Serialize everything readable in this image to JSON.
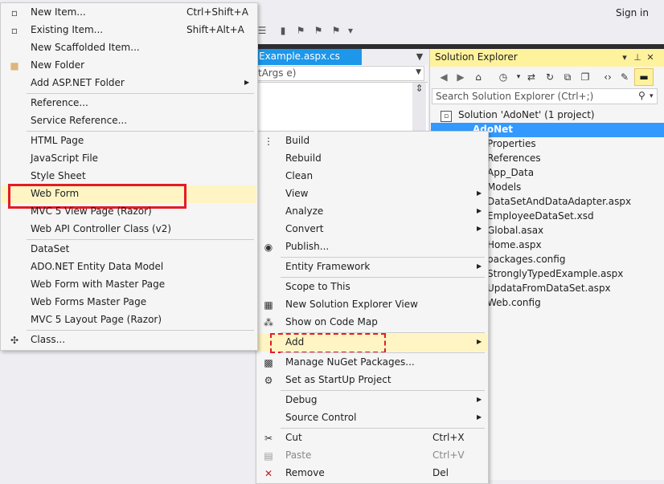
{
  "topbar": {
    "signin": "Sign in"
  },
  "editor": {
    "tab_title": "Example.aspx.cs",
    "nav_combo": "tArgs e)"
  },
  "solution_explorer": {
    "title": "Solution Explorer",
    "search_placeholder": "Search Solution Explorer (Ctrl+;)",
    "solution": "Solution 'AdoNet' (1 project)",
    "project": "AdoNet",
    "items": [
      "Properties",
      "References",
      "App_Data",
      "Models",
      "DataSetAndDataAdapter.aspx",
      "EmployeeDataSet.xsd",
      "Global.asax",
      "Home.aspx",
      "packages.config",
      "StronglyTypedExample.aspx",
      "UpdataFromDataSet.aspx",
      "Web.config"
    ]
  },
  "add_menu": {
    "items": [
      {
        "label": "New Item...",
        "shortcut": "Ctrl+Shift+A",
        "icon": "new-item-icon"
      },
      {
        "label": "Existing Item...",
        "shortcut": "Shift+Alt+A",
        "icon": "existing-item-icon"
      },
      {
        "label": "New Scaffolded Item...",
        "shortcut": "",
        "icon": ""
      },
      {
        "label": "New Folder",
        "shortcut": "",
        "icon": "folder-icon"
      },
      {
        "label": "Add ASP.NET Folder",
        "shortcut": "",
        "icon": "",
        "submenu": true
      },
      {
        "label": "Reference...",
        "shortcut": "",
        "icon": ""
      },
      {
        "label": "Service Reference...",
        "shortcut": "",
        "icon": ""
      },
      {
        "label": "HTML Page",
        "shortcut": "",
        "icon": ""
      },
      {
        "label": "JavaScript File",
        "shortcut": "",
        "icon": ""
      },
      {
        "label": "Style Sheet",
        "shortcut": "",
        "icon": ""
      },
      {
        "label": "Web Form",
        "shortcut": "",
        "icon": "",
        "highlight": true
      },
      {
        "label": "MVC 5 View Page (Razor)",
        "shortcut": "",
        "icon": ""
      },
      {
        "label": "Web API Controller Class (v2)",
        "shortcut": "",
        "icon": ""
      },
      {
        "label": "DataSet",
        "shortcut": "",
        "icon": ""
      },
      {
        "label": "ADO.NET Entity Data Model",
        "shortcut": "",
        "icon": ""
      },
      {
        "label": "Web Form with Master Page",
        "shortcut": "",
        "icon": ""
      },
      {
        "label": "Web Forms Master Page",
        "shortcut": "",
        "icon": ""
      },
      {
        "label": "MVC 5 Layout Page (Razor)",
        "shortcut": "",
        "icon": ""
      },
      {
        "label": "Class...",
        "shortcut": "",
        "icon": "class-icon"
      }
    ]
  },
  "context_menu": {
    "items": [
      {
        "label": "Build",
        "shortcut": "",
        "icon": "build-icon"
      },
      {
        "label": "Rebuild",
        "shortcut": ""
      },
      {
        "label": "Clean",
        "shortcut": ""
      },
      {
        "label": "View",
        "submenu": true
      },
      {
        "label": "Analyze",
        "submenu": true
      },
      {
        "label": "Convert",
        "submenu": true
      },
      {
        "label": "Publish...",
        "icon": "publish-icon"
      },
      {
        "label": "Entity Framework",
        "submenu": true
      },
      {
        "label": "Scope to This"
      },
      {
        "label": "New Solution Explorer View",
        "icon": "new-view-icon"
      },
      {
        "label": "Show on Code Map",
        "icon": "code-map-icon"
      },
      {
        "label": "Add",
        "submenu": true,
        "highlight": true
      },
      {
        "label": "Manage NuGet Packages...",
        "icon": "nuget-icon"
      },
      {
        "label": "Set as StartUp Project",
        "icon": "gear-icon"
      },
      {
        "label": "Debug",
        "submenu": true
      },
      {
        "label": "Source Control",
        "submenu": true
      },
      {
        "label": "Cut",
        "shortcut": "Ctrl+X",
        "icon": "cut-icon"
      },
      {
        "label": "Paste",
        "shortcut": "Ctrl+V",
        "icon": "paste-icon",
        "disabled": true
      },
      {
        "label": "Remove",
        "shortcut": "Del",
        "icon": "remove-icon"
      }
    ]
  }
}
